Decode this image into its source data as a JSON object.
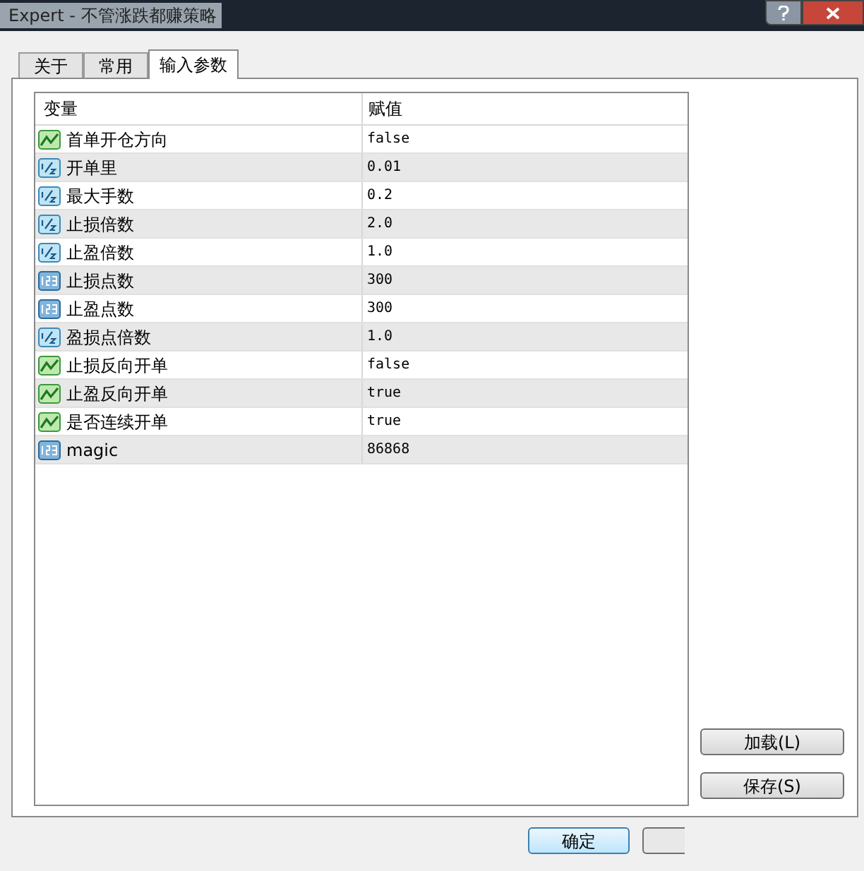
{
  "window": {
    "title": "Expert - 不管涨跌都赚策略"
  },
  "tabs": [
    {
      "label": "关于",
      "selected": false
    },
    {
      "label": "常用",
      "selected": false
    },
    {
      "label": "输入参数",
      "selected": true
    }
  ],
  "table": {
    "columns": [
      "变量",
      "赋值"
    ],
    "rows": [
      {
        "kind": "bool",
        "name": "首单开仓方向",
        "value": "false"
      },
      {
        "kind": "double",
        "name": "开单里",
        "value": "0.01"
      },
      {
        "kind": "double",
        "name": "最大手数",
        "value": "0.2"
      },
      {
        "kind": "double",
        "name": "止损倍数",
        "value": "2.0"
      },
      {
        "kind": "double",
        "name": "止盈倍数",
        "value": "1.0"
      },
      {
        "kind": "int",
        "name": "止损点数",
        "value": "300"
      },
      {
        "kind": "int",
        "name": "止盈点数",
        "value": "300"
      },
      {
        "kind": "double",
        "name": "盈损点倍数",
        "value": "1.0"
      },
      {
        "kind": "bool",
        "name": "止损反向开单",
        "value": "false"
      },
      {
        "kind": "bool",
        "name": "止盈反向开单",
        "value": "true"
      },
      {
        "kind": "bool",
        "name": "是否连续开单",
        "value": "true"
      },
      {
        "kind": "int",
        "name": "magic",
        "value": "86868"
      }
    ]
  },
  "side_buttons": [
    "加载(L)",
    "保存(S)"
  ],
  "footer_buttons": [
    "确定"
  ]
}
